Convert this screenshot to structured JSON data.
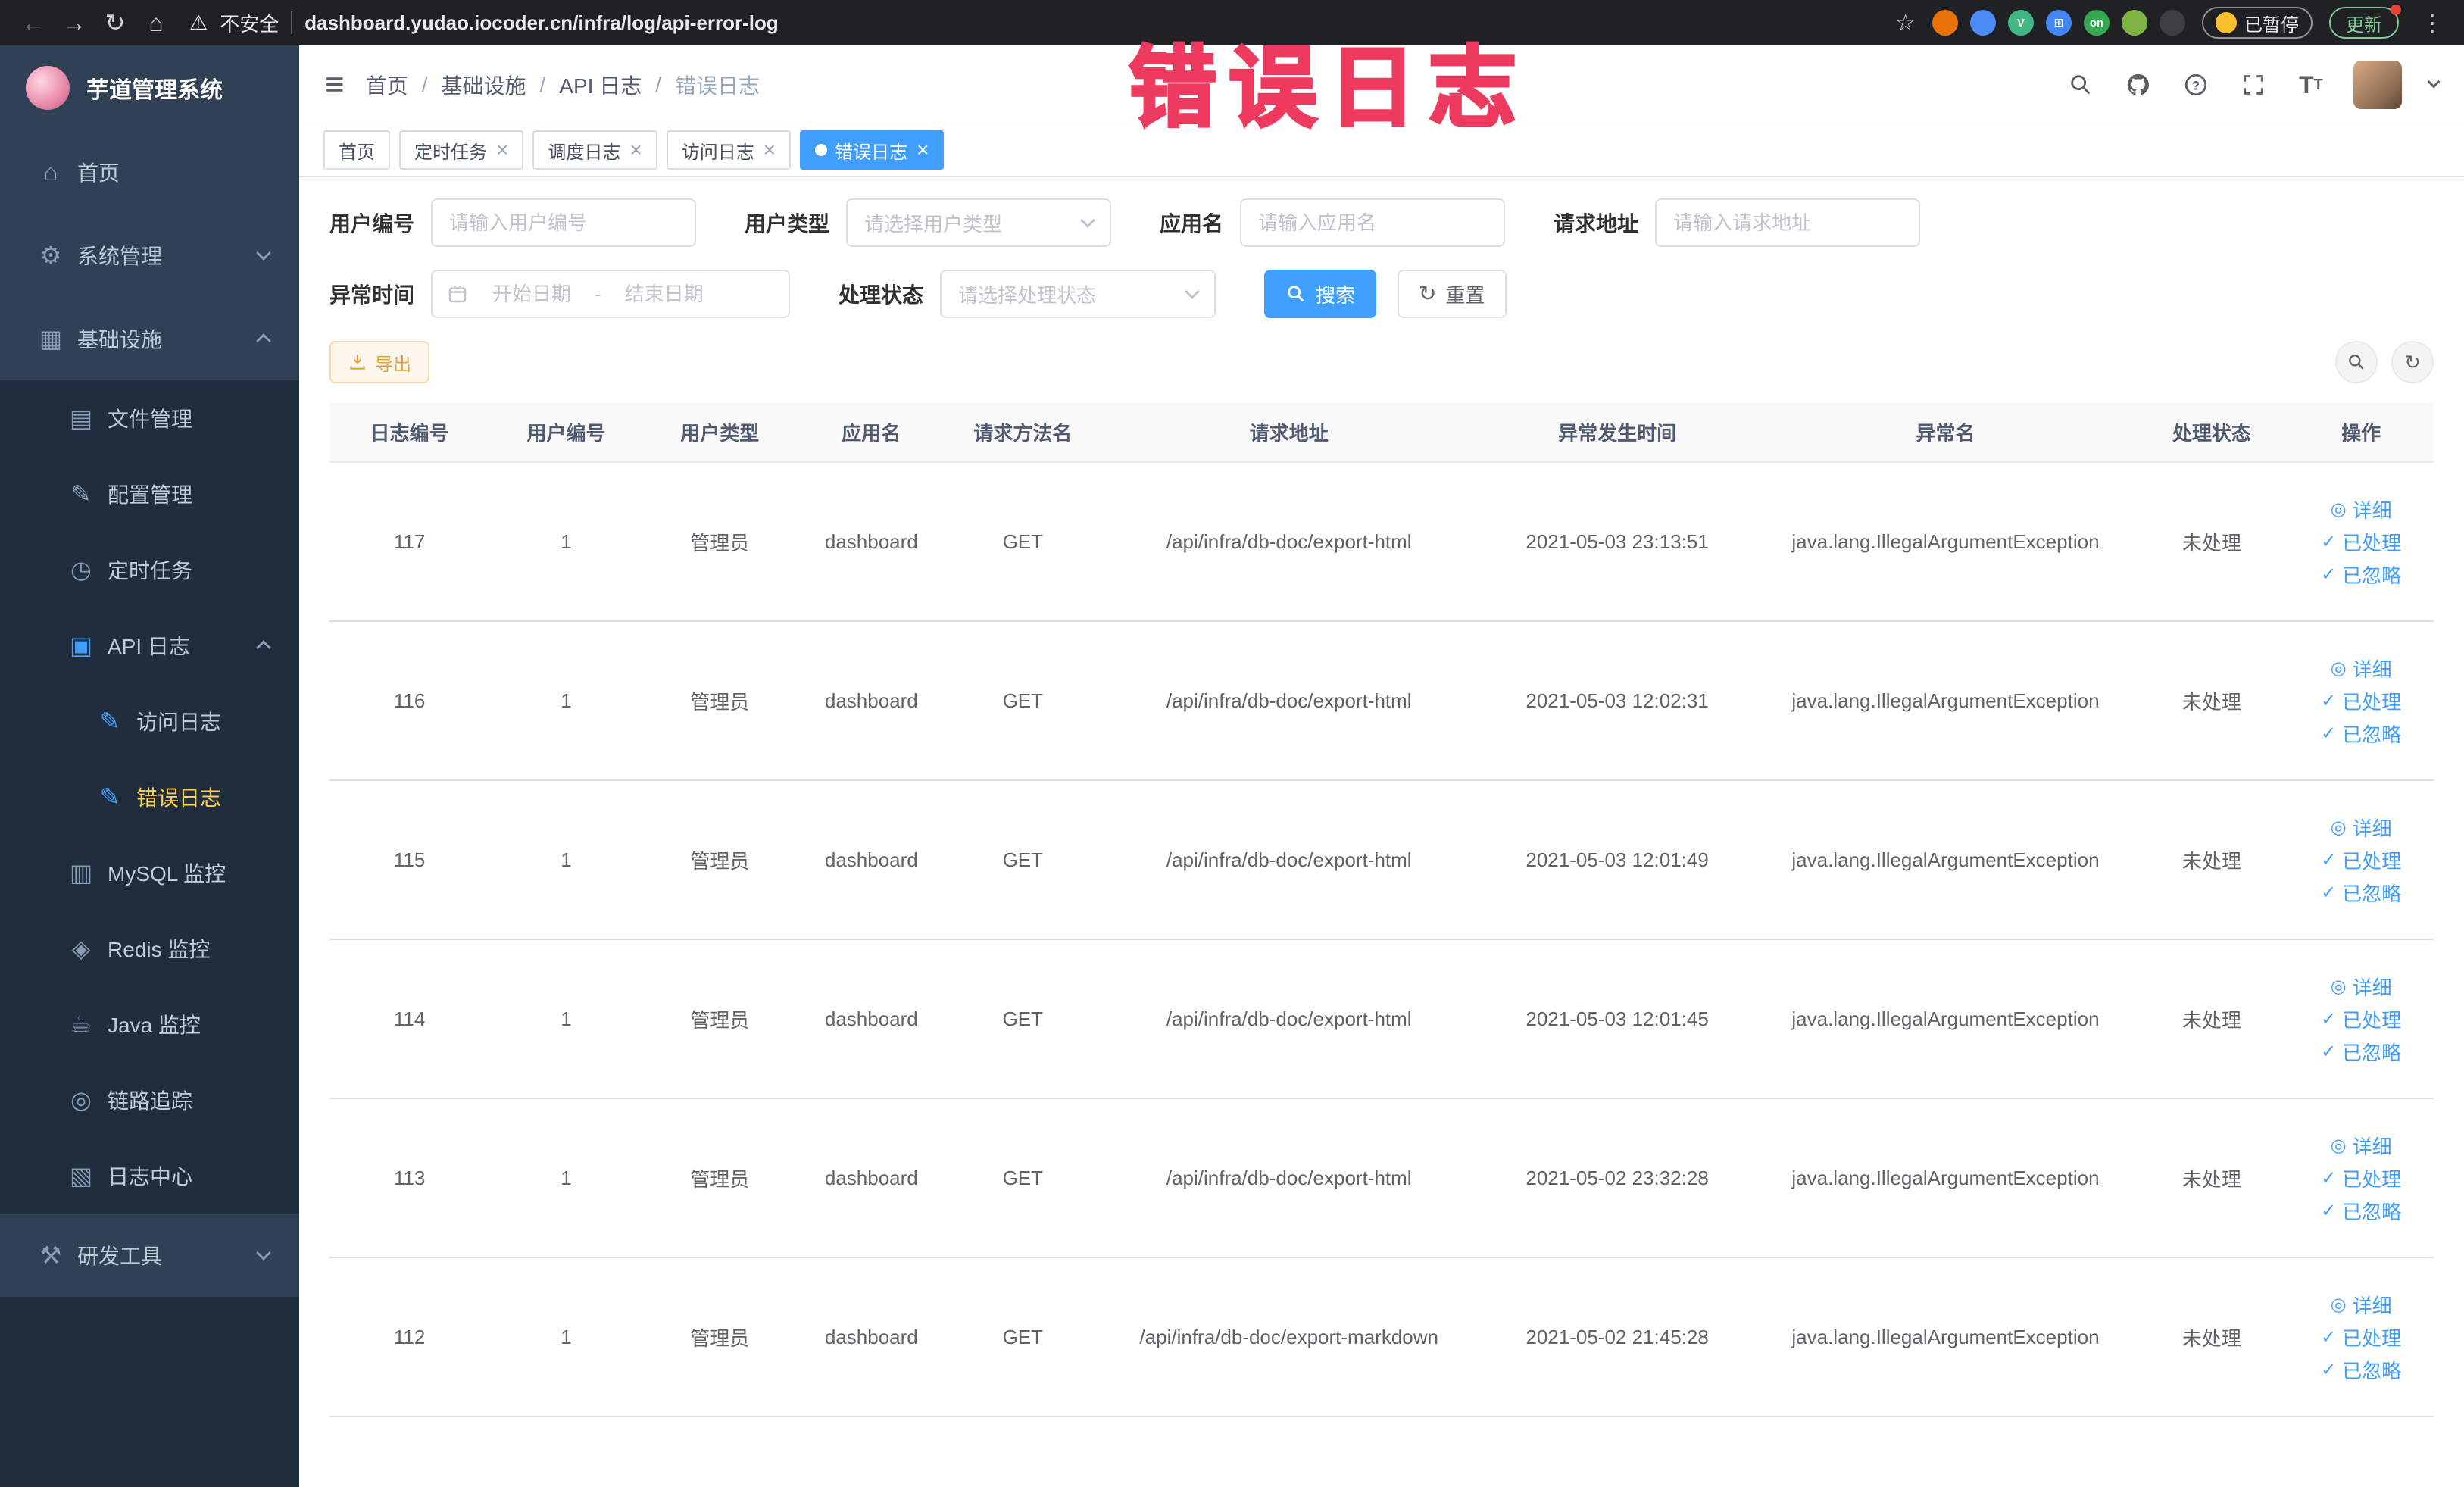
{
  "theme": {
    "accent": "#409eff",
    "warning": "#e6a23c",
    "annotation": "#ee3a5e",
    "sidebar_bg": "#304156",
    "sidebar_sub_bg": "#1f2d3d",
    "sidebar_active": "#ffd04b"
  },
  "annotation": {
    "text": "错误日志"
  },
  "browser": {
    "security_text": "不安全",
    "url": "dashboard.yudao.iocoder.cn/infra/log/api-error-log",
    "paused_label": "已暂停",
    "update_label": "更新",
    "nav_icons": [
      {
        "name": "back-icon",
        "glyph": "←",
        "disabled": true
      },
      {
        "name": "forward-icon",
        "glyph": "→",
        "disabled": false
      },
      {
        "name": "reload-icon",
        "glyph": "↻",
        "disabled": false
      },
      {
        "name": "home-icon",
        "glyph": "⌂",
        "disabled": false
      }
    ],
    "extensions": [
      {
        "name": "extension-orange-circle",
        "color": "#e8710a",
        "letter": ""
      },
      {
        "name": "extension-blue-drop",
        "color": "#4c8bf5",
        "letter": ""
      },
      {
        "name": "extension-vue-devtools",
        "color": "#41b883",
        "letter": "V"
      },
      {
        "name": "extension-blue-grid",
        "color": "#4285f4",
        "letter": "⊞"
      },
      {
        "name": "extension-on-badge",
        "color": "#34a853",
        "letter": "on"
      },
      {
        "name": "extension-leaf",
        "color": "#7cb342",
        "letter": ""
      },
      {
        "name": "extension-plug",
        "color": "#3c4043",
        "letter": ""
      }
    ]
  },
  "sidebar": {
    "logo_title": "芋道管理系统",
    "items": [
      {
        "key": "home",
        "label": "首页",
        "glyph": "⌂",
        "level": 1
      },
      {
        "key": "system",
        "label": "系统管理",
        "glyph": "⚙",
        "level": 1,
        "chevron": "down"
      },
      {
        "key": "infra",
        "label": "基础设施",
        "glyph": "▦",
        "level": 1,
        "chevron": "up"
      },
      {
        "key": "file",
        "label": "文件管理",
        "glyph": "▤",
        "level": 2
      },
      {
        "key": "config",
        "label": "配置管理",
        "glyph": "✎",
        "level": 2
      },
      {
        "key": "job",
        "label": "定时任务",
        "glyph": "◷",
        "level": 2
      },
      {
        "key": "api-log",
        "label": "API 日志",
        "glyph": "▣",
        "level": 2,
        "chevron": "up",
        "icon_accent": true
      },
      {
        "key": "access-log",
        "label": "访问日志",
        "glyph": "✎",
        "level": 3,
        "icon_accent": true
      },
      {
        "key": "error-log",
        "label": "错误日志",
        "glyph": "✎",
        "level": 3,
        "icon_accent": true,
        "active": true
      },
      {
        "key": "mysql",
        "label": "MySQL 监控",
        "glyph": "▥",
        "level": 2
      },
      {
        "key": "redis",
        "label": "Redis 监控",
        "glyph": "◈",
        "level": 2
      },
      {
        "key": "java",
        "label": "Java 监控",
        "glyph": "☕",
        "level": 2
      },
      {
        "key": "trace",
        "label": "链路追踪",
        "glyph": "◎",
        "level": 2
      },
      {
        "key": "log-center",
        "label": "日志中心",
        "glyph": "▧",
        "level": 2
      },
      {
        "key": "dev-tools",
        "label": "研发工具",
        "glyph": "⚒",
        "level": 1,
        "chevron": "down"
      }
    ]
  },
  "breadcrumb": [
    "首页",
    "基础设施",
    "API 日志",
    "错误日志"
  ],
  "tabs": [
    {
      "key": "home",
      "label": "首页",
      "closable": false,
      "active": false
    },
    {
      "key": "job",
      "label": "定时任务",
      "closable": true,
      "active": false
    },
    {
      "key": "job-log",
      "label": "调度日志",
      "closable": true,
      "active": false
    },
    {
      "key": "access-log",
      "label": "访问日志",
      "closable": true,
      "active": false
    },
    {
      "key": "error-log",
      "label": "错误日志",
      "closable": true,
      "active": true
    }
  ],
  "filters": {
    "user_id": {
      "label": "用户编号",
      "placeholder": "请输入用户编号"
    },
    "user_type": {
      "label": "用户类型",
      "placeholder": "请选择用户类型"
    },
    "app_name": {
      "label": "应用名",
      "placeholder": "请输入应用名"
    },
    "request_url": {
      "label": "请求地址",
      "placeholder": "请输入请求地址"
    },
    "exception_time": {
      "label": "异常时间",
      "start_placeholder": "开始日期",
      "end_placeholder": "结束日期",
      "separator": "-"
    },
    "process_status": {
      "label": "处理状态",
      "placeholder": "请选择处理状态"
    }
  },
  "buttons": {
    "search": "搜索",
    "reset": "重置",
    "export": "导出"
  },
  "table": {
    "columns": [
      "日志编号",
      "用户编号",
      "用户类型",
      "应用名",
      "请求方法名",
      "请求地址",
      "异常发生时间",
      "异常名",
      "处理状态",
      "操作"
    ],
    "keys": [
      "log-id",
      "user-id",
      "user-type",
      "app-name",
      "method",
      "url",
      "time",
      "exception",
      "status"
    ],
    "actions": [
      {
        "name": "detail-link",
        "glyph": "◎",
        "label": "详细"
      },
      {
        "name": "processed-link",
        "glyph": "✓",
        "label": "已处理"
      },
      {
        "name": "ignored-link",
        "glyph": "✓",
        "label": "已忽略"
      }
    ],
    "rows": [
      {
        "id": "117",
        "user_id": "1",
        "user_type": "管理员",
        "app": "dashboard",
        "method": "GET",
        "url": "/api/infra/db-doc/export-html",
        "time": "2021-05-03 23:13:51",
        "exception": "java.lang.IllegalArgumentException",
        "status": "未处理"
      },
      {
        "id": "116",
        "user_id": "1",
        "user_type": "管理员",
        "app": "dashboard",
        "method": "GET",
        "url": "/api/infra/db-doc/export-html",
        "time": "2021-05-03 12:02:31",
        "exception": "java.lang.IllegalArgumentException",
        "status": "未处理"
      },
      {
        "id": "115",
        "user_id": "1",
        "user_type": "管理员",
        "app": "dashboard",
        "method": "GET",
        "url": "/api/infra/db-doc/export-html",
        "time": "2021-05-03 12:01:49",
        "exception": "java.lang.IllegalArgumentException",
        "status": "未处理"
      },
      {
        "id": "114",
        "user_id": "1",
        "user_type": "管理员",
        "app": "dashboard",
        "method": "GET",
        "url": "/api/infra/db-doc/export-html",
        "time": "2021-05-03 12:01:45",
        "exception": "java.lang.IllegalArgumentException",
        "status": "未处理"
      },
      {
        "id": "113",
        "user_id": "1",
        "user_type": "管理员",
        "app": "dashboard",
        "method": "GET",
        "url": "/api/infra/db-doc/export-html",
        "time": "2021-05-02 23:32:28",
        "exception": "java.lang.IllegalArgumentException",
        "status": "未处理"
      },
      {
        "id": "112",
        "user_id": "1",
        "user_type": "管理员",
        "app": "dashboard",
        "method": "GET",
        "url": "/api/infra/db-doc/export-markdown",
        "time": "2021-05-02 21:45:28",
        "exception": "java.lang.IllegalArgumentException",
        "status": "未处理"
      }
    ]
  }
}
